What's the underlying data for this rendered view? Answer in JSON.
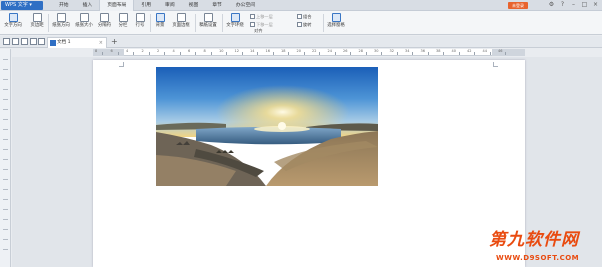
{
  "app": {
    "title": "WPS 文字",
    "login_label": "未登录"
  },
  "menu": [
    "开始",
    "插入",
    "页面布局",
    "引用",
    "审阅",
    "视图",
    "章节",
    "办公空间"
  ],
  "active_menu_index": 2,
  "ribbon": {
    "text_direction": "文字方向",
    "margins": "页边距",
    "orientation": "纸张方向",
    "size": "纸张大小",
    "separator": "分隔符",
    "columns": "分栏",
    "line_numbers": "行号",
    "background": "背景",
    "page_border": "页面边框",
    "draft_setting": "稿纸设置",
    "text_wrap": "文字环绕",
    "bring_forward": "上移一层",
    "send_backward": "下移一层",
    "align": "对齐",
    "group": "组合",
    "rotate": "旋转",
    "selection_pane": "选择窗格"
  },
  "document": {
    "tab_name": "文档 1"
  },
  "ruler": {
    "numbers": [
      "8",
      "6",
      "4",
      "2",
      "2",
      "4",
      "6",
      "8",
      "10",
      "12",
      "14",
      "16",
      "18",
      "20",
      "22",
      "24",
      "26",
      "28",
      "30",
      "32",
      "34",
      "36",
      "38",
      "40",
      "42",
      "44",
      "46"
    ]
  },
  "watermark": {
    "main": "第九软件网",
    "sub": "WWW.D9SOFT.COM"
  },
  "colors": {
    "app_button": "#2f6fc4",
    "login": "#e8632d",
    "watermark": "#e94b10"
  },
  "icons": [
    "wps-logo-icon",
    "save-icon",
    "print-icon",
    "undo-icon",
    "redo-icon",
    "close-icon",
    "plus-icon",
    "minimize-icon",
    "maximize-icon",
    "window-close-icon"
  ]
}
